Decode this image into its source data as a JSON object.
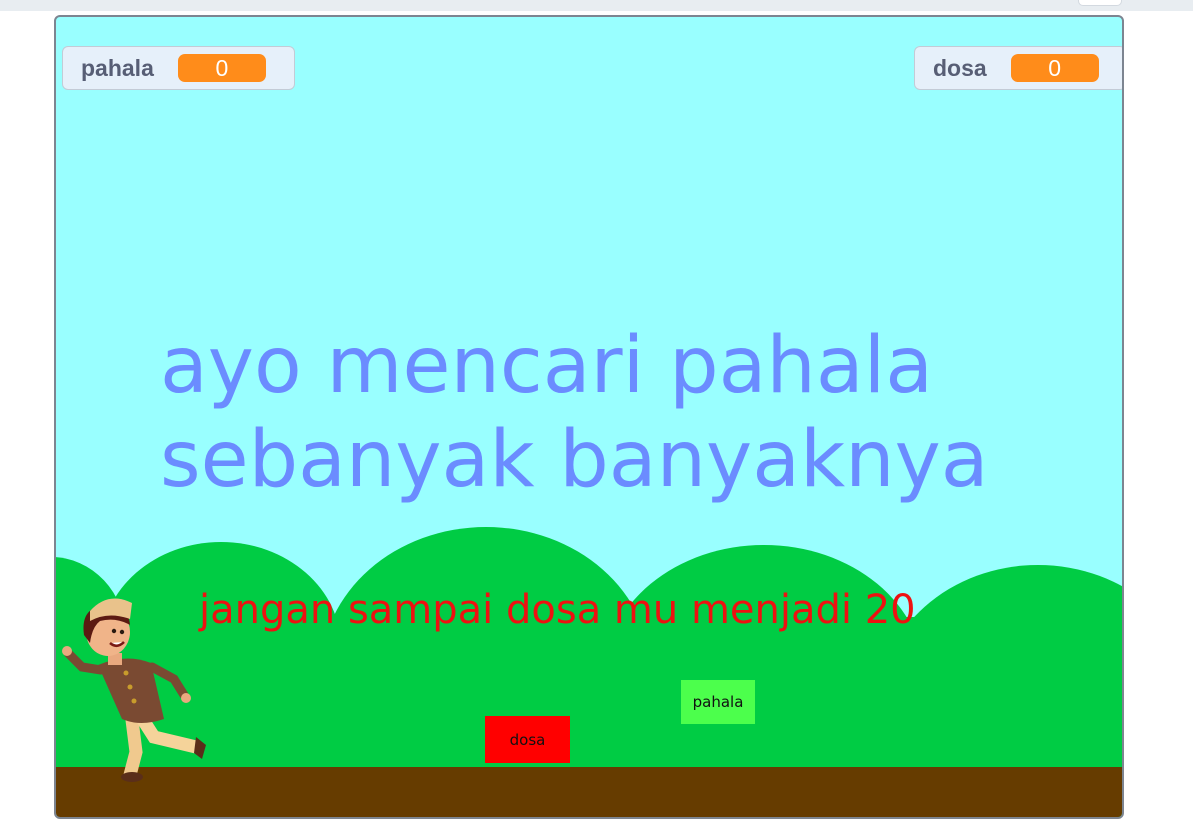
{
  "stage": {
    "background_color": "#99ffff",
    "hill_color": "#00cc44",
    "ground_color": "#663c00"
  },
  "monitors": {
    "pahala": {
      "label": "pahala",
      "value": "0"
    },
    "dosa": {
      "label": "dosa",
      "value": "0"
    }
  },
  "messages": {
    "headline_line1": "ayo mencari pahala",
    "headline_line2": "sebanyak banyaknya",
    "warning": "jangan sampai dosa mu menjadi 20"
  },
  "sprites": {
    "dosa_item": {
      "label": "dosa",
      "color": "#ff0000"
    },
    "pahala_item": {
      "label": "pahala",
      "color": "#4cff4c"
    },
    "player": {
      "icon": "boy-running-sprite"
    }
  }
}
